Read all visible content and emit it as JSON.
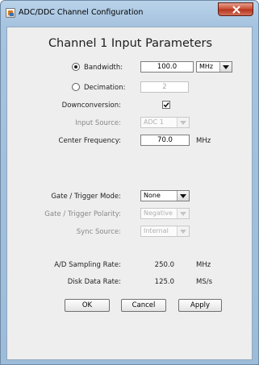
{
  "window": {
    "title": "ADC/DDC Channel Configuration",
    "close_icon": "close-icon",
    "app_icon": "java-app-icon"
  },
  "heading": "Channel 1 Input Parameters",
  "bandwidth": {
    "label": "Bandwidth:",
    "selected": true,
    "value": "100.0",
    "unit_selected": "MHz"
  },
  "decimation": {
    "label": "Decimation:",
    "selected": false,
    "value": "2"
  },
  "downconversion": {
    "label": "Downconversion:",
    "checked": true
  },
  "input_source": {
    "label": "Input Source:",
    "value": "ADC 1"
  },
  "center_frequency": {
    "label": "Center Frequency:",
    "value": "70.0",
    "unit": "MHz"
  },
  "gate_trigger_mode": {
    "label": "Gate / Trigger Mode:",
    "value": "None"
  },
  "gate_trigger_polarity": {
    "label": "Gate / Trigger Polarity:",
    "value": "Negative"
  },
  "sync_source": {
    "label": "Sync Source:",
    "value": "Internal"
  },
  "ad_sampling_rate": {
    "label": "A/D Sampling Rate:",
    "value": "250.0",
    "unit": "MHz"
  },
  "disk_data_rate": {
    "label": "Disk Data Rate:",
    "value": "125.0",
    "unit": "MS/s"
  },
  "buttons": {
    "ok": "OK",
    "cancel": "Cancel",
    "apply": "Apply"
  }
}
